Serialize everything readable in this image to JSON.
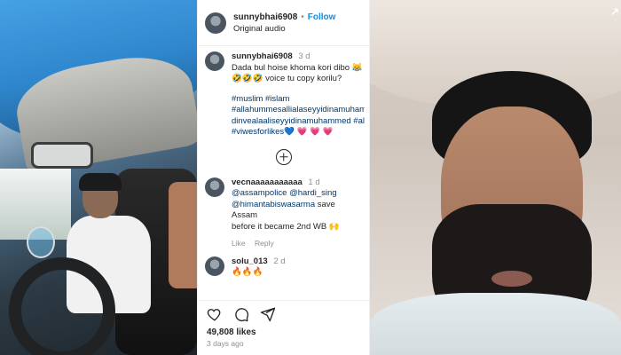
{
  "post": {
    "username": "sunnybhai6908",
    "follow_label": "Follow",
    "audio": "Original audio",
    "caption_username": "sunnybhai6908",
    "caption_time": "3 d",
    "caption_line1": "Dada bul hoise khoma kori dibo 😹",
    "caption_line2": "🤣🤣🤣 voice tu copy korilu?",
    "hashtags": [
      "#muslim #islam",
      "#allahummesallialaseyyidinamuhammed",
      "dinvealaaliseyyidinamuhammed #allah",
      "#viwesforlikes💙 💗 💗 💗"
    ],
    "likes": "49,808 likes",
    "posted": "3 days ago"
  },
  "comments": [
    {
      "username": "vecnaaaaaaaaaaa",
      "time": "1 d",
      "mentions": "@assampolice @hardi_sing",
      "mention2": "@himantabiswasarma",
      "text_after_mention": "save Assam",
      "text_line2": "before it became 2nd WB 🙌",
      "like_label": "Like",
      "reply_label": "Reply"
    },
    {
      "username": "solu_013",
      "time": "2 d",
      "text": "🔥🔥🔥"
    }
  ],
  "corner_glyph": "↗"
}
